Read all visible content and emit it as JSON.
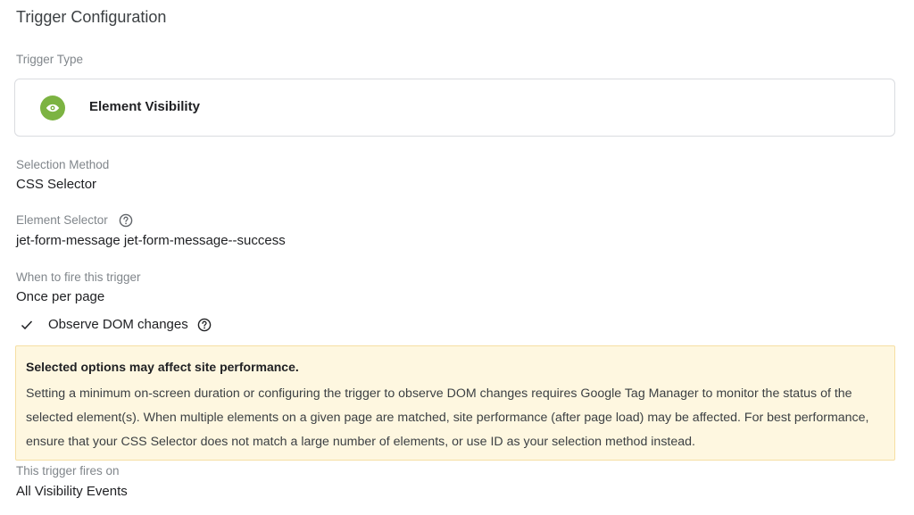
{
  "header": {
    "title": "Trigger Configuration"
  },
  "trigger_type": {
    "label": "Trigger Type",
    "name": "Element Visibility",
    "icon": "eye-icon",
    "icon_color": "#7cb342"
  },
  "selection_method": {
    "label": "Selection Method",
    "value": "CSS Selector"
  },
  "element_selector": {
    "label": "Element Selector",
    "value": "jet-form-message jet-form-message--success"
  },
  "fire": {
    "label": "When to fire this trigger",
    "value": "Once per page"
  },
  "observe_dom": {
    "label": "Observe DOM changes",
    "checked": true
  },
  "warning": {
    "title": "Selected options may affect site performance.",
    "body": "Setting a minimum on-screen duration or configuring the trigger to observe DOM changes requires Google Tag Manager to monitor the status of the selected element(s). When multiple elements on a given page are matched, site performance (after page load) may be affected. For best performance, ensure that your CSS Selector does not match a large number of elements, or use ID as your selection method instead.",
    "background": "#fef7e0"
  },
  "fires_on": {
    "label": "This trigger fires on",
    "value": "All Visibility Events"
  }
}
